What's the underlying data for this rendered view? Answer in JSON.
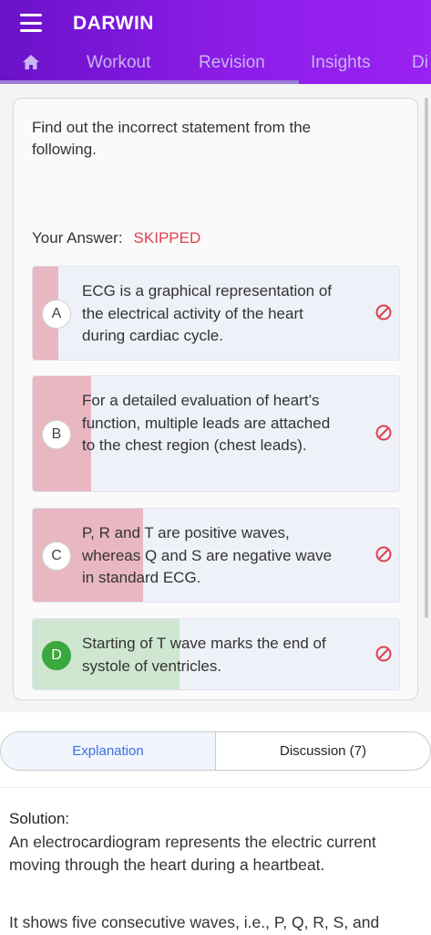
{
  "app": {
    "title": "DARWIN",
    "tabs": [
      {
        "label": "Workout"
      },
      {
        "label": "Revision"
      },
      {
        "label": "Insights"
      },
      {
        "label": "Di"
      }
    ]
  },
  "question": {
    "text": "Find out the incorrect statement from the following.",
    "answer_label": "Your Answer:",
    "answer_value": "SKIPPED",
    "options": [
      {
        "letter": "A",
        "text": "ECG is a graphical representation of the electrical activity of the heart during cardiac cycle.",
        "response_fraction": 0.07,
        "fill_color": "#e9b7c1"
      },
      {
        "letter": "B",
        "text": "For a detailed evaluation of heart’s function, multiple leads are attached to the chest region (chest leads).",
        "response_fraction": 0.16,
        "fill_color": "#e9b7c1"
      },
      {
        "letter": "C",
        "text": "P, R and T are positive waves, whereas Q and S are negative wave in standard ECG.",
        "response_fraction": 0.3,
        "fill_color": "#e9b7c1"
      },
      {
        "letter": "D",
        "text": "Starting of T wave marks the end of systole of ventricles.",
        "response_fraction": 0.4,
        "fill_color": "#cfe6d1"
      }
    ]
  },
  "explanation_tabs": {
    "explanation": "Explanation",
    "discussion": "Discussion (7)"
  },
  "solution": {
    "title": "Solution:",
    "p1": "An electrocardiogram represents the electric current moving through the heart during a heartbeat.",
    "p2": "It shows five consecutive waves, i.e., P, Q, R, S, and"
  },
  "colors": {
    "brand_start": "#6a12c9",
    "brand_end": "#9a22f2",
    "skipped": "#e0414f",
    "incorrect_fill": "#e9b7c1",
    "correct_fill": "#cfe6d1",
    "correct_circle": "#3aa83e",
    "accent_link": "#3b6fe0"
  }
}
